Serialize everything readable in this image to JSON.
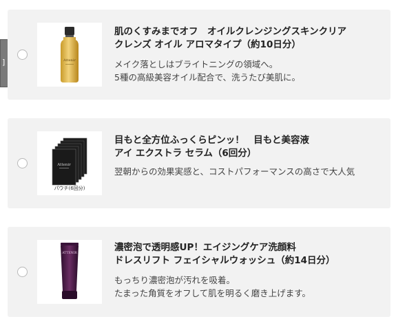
{
  "side_tab": {
    "glyph": "]"
  },
  "products": [
    {
      "title_line1": "肌のくすみまでオフ　オイルクレンジングスキンクリア",
      "title_line2": "クレンズ オイル アロマタイプ（約10日分）",
      "desc_line1": "メイク落としはブライトニングの領域へ。",
      "desc_line2": "5種の高級美容オイル配合で、洗うたび美肌に。",
      "image_alt": "オイルボトル",
      "bottle_brand": "Attenir"
    },
    {
      "title_line1": "目もと全方位ふっくらピンッ！　目もと美容液",
      "title_line2": "アイ エクストラ セラム（6回分）",
      "desc_line1": "翌朝からの効果実感と、コストパフォーマンスの高さで大人気",
      "desc_line2": "",
      "image_caption": "パウチ(6回分)",
      "pouch_brand": "Attenir"
    },
    {
      "title_line1": "濃密泡で透明感UP！エイジングケア洗顔料",
      "title_line2": "ドレスリフト フェイシャルウォッシュ（約14日分）",
      "desc_line1": "もっちり濃密泡が汚れを吸着。",
      "desc_line2": "たまった角質をオフして肌を明るく磨き上げます。",
      "tube_brand": "ATTENIR"
    }
  ],
  "colors": {
    "card_bg": "#f2f2f2",
    "radio_border": "#b8b8b8",
    "tab": "#7a7a7a"
  }
}
